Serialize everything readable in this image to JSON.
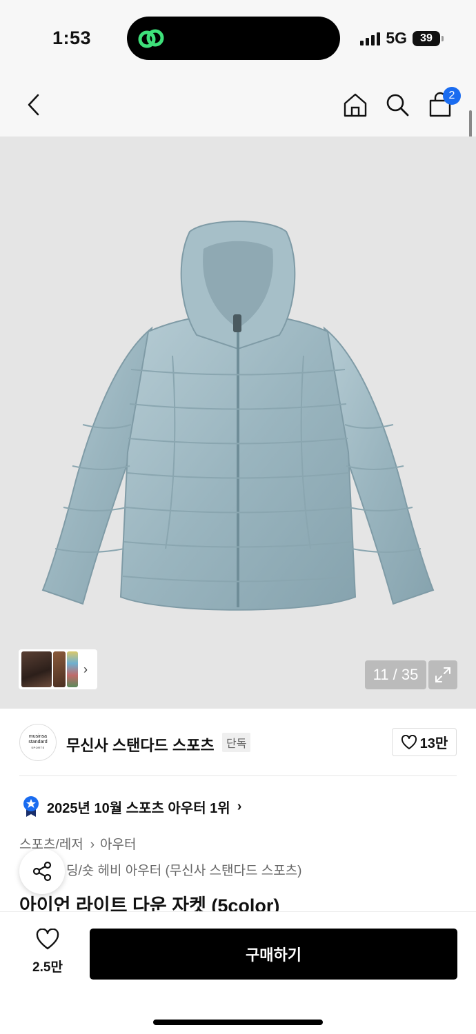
{
  "status": {
    "time": "1:53",
    "network": "5G",
    "battery": "39"
  },
  "nav": {
    "cart_count": "2"
  },
  "gallery": {
    "counter": "11 / 35"
  },
  "brand": {
    "name": "무신사 스탠다드 스포츠",
    "badge": "단독",
    "likes": "13만",
    "logo_line1": "musinsa",
    "logo_line2": "standard",
    "logo_line3": "SPORTS"
  },
  "ranking": {
    "text": "2025년 10월 스포츠 아우터 1위"
  },
  "category": {
    "main": "스포츠/레저",
    "sub": "아우터",
    "detail": "딩/숏 헤비 아우터 (무신사 스탠다드 스포츠)"
  },
  "product": {
    "title": "아이언 라이트 다운 자켓 (5color)"
  },
  "bottom": {
    "fav_count": "2.5만",
    "buy_label": "구매하기"
  },
  "colors": {
    "accent": "#1a6cf0",
    "jacket": "#9fb9c2",
    "island_icon": "#3ee07a"
  }
}
